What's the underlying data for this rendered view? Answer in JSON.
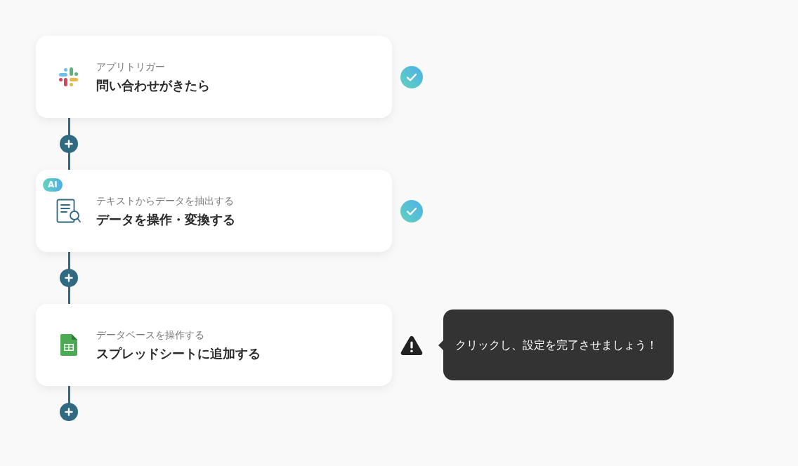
{
  "steps": [
    {
      "kind": "slack",
      "category": "アプリトリガー",
      "title": "問い合わせがきたら",
      "complete": true
    },
    {
      "kind": "extract",
      "badge": "AI",
      "category": "テキストからデータを抽出する",
      "title": "データを操作・変換する",
      "complete": true
    },
    {
      "kind": "sheets",
      "category": "データベースを操作する",
      "title": "スプレッドシートに追加する",
      "complete": false,
      "tooltip": "クリックし、設定を完了させましょう！"
    }
  ]
}
